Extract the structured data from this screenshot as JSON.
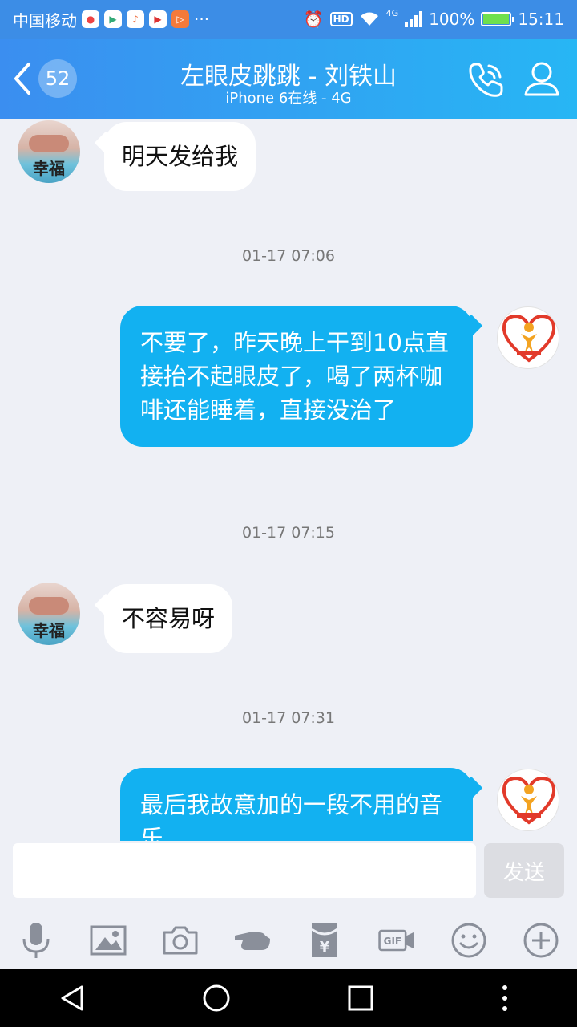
{
  "status_bar": {
    "carrier": "中国移动",
    "more": "···",
    "hd": "HD",
    "network": "4G",
    "battery": "100%",
    "battery_level": 1.0,
    "time": "15:11"
  },
  "header": {
    "unread_count": "52",
    "title": "左眼皮跳跳 - 刘铁山",
    "subtitle": "iPhone 6在线 - 4G"
  },
  "messages": [
    {
      "direction": "in",
      "text": "明天发给我"
    },
    {
      "timestamp": "01-17 07:06"
    },
    {
      "direction": "out",
      "text": "不要了，昨天晚上干到10点直接抬不起眼皮了，喝了两杯咖啡还能睡着，直接没治了"
    },
    {
      "timestamp": "01-17 07:15"
    },
    {
      "direction": "in",
      "text": "不容易呀"
    },
    {
      "timestamp": "01-17 07:31"
    },
    {
      "direction": "out",
      "text": "最后我故意加的一段不用的音乐"
    }
  ],
  "avatars": {
    "left_word": "幸福"
  },
  "input": {
    "placeholder": "",
    "send_label": "发送"
  },
  "toolbar_icons": [
    "mic-icon",
    "image-icon",
    "camera-icon",
    "poke-icon",
    "red-packet-icon",
    "gif-icon",
    "emoji-icon",
    "plus-icon"
  ],
  "colors": {
    "header_start": "#3b8ef0",
    "header_end": "#27b6f4",
    "outgoing_bubble": "#12b1f1",
    "incoming_bubble": "#ffffff",
    "background": "#eef0f6"
  }
}
